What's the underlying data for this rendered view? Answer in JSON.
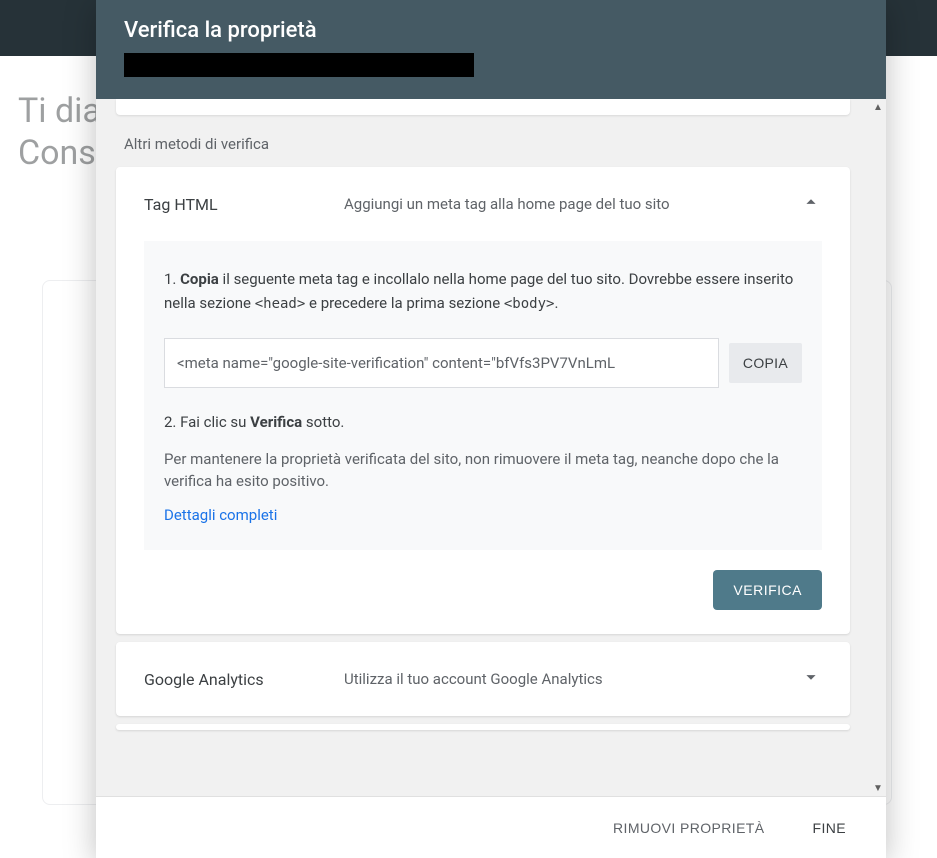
{
  "background": {
    "title_line1": "Ti dia",
    "title_line2": "Cons"
  },
  "modal": {
    "title": "Verifica la proprietà",
    "section_label": "Altri metodi di verifica",
    "html_tag": {
      "title": "Tag HTML",
      "description": "Aggiungi un meta tag alla home page del tuo sito",
      "step1_prefix": "1. ",
      "step1_bold": "Copia",
      "step1_rest": " il seguente meta tag e incollalo nella home page del tuo sito. Dovrebbe essere inserito nella sezione ",
      "step1_code1": "<head>",
      "step1_mid": " e precedere la prima sezione ",
      "step1_code2": "<body>",
      "step1_end": ".",
      "meta_value": "<meta name=\"google-site-verification\" content=\"bfVfs3PV7VnLmL",
      "copy_btn": "COPIA",
      "step2_prefix": "2. Fai clic su ",
      "step2_bold": "Verifica",
      "step2_rest": " sotto.",
      "note": "Per mantenere la proprietà verificata del sito, non rimuovere il meta tag, neanche dopo che la verifica ha esito positivo.",
      "details": "Dettagli completi",
      "verify_btn": "VERIFICA"
    },
    "analytics": {
      "title": "Google Analytics",
      "description": "Utilizza il tuo account Google Analytics"
    },
    "footer": {
      "remove": "RIMUOVI PROPRIETÀ",
      "done": "FINE"
    }
  }
}
